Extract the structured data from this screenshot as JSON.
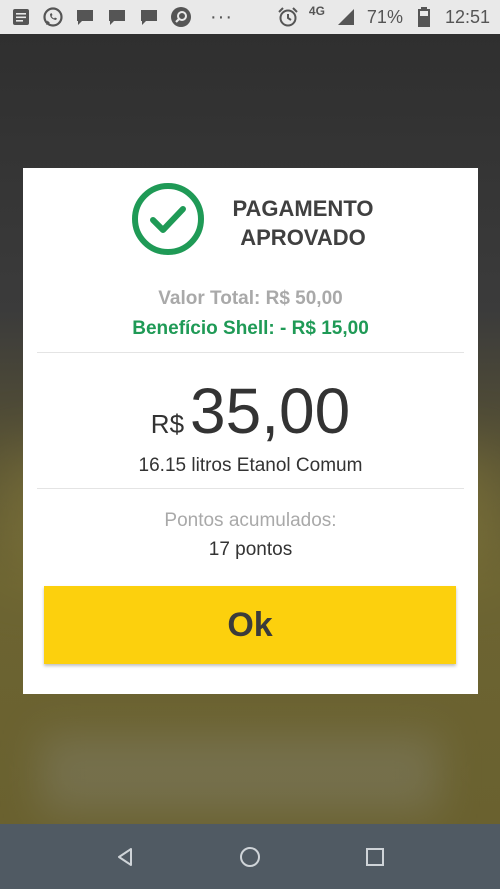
{
  "status_bar": {
    "battery_percent": "71%",
    "network": "4G",
    "time": "12:51",
    "overflow": "···"
  },
  "dialog": {
    "title_line1": "PAGAMENTO",
    "title_line2": "APROVADO",
    "total_value": "Valor Total: R$ 50,00",
    "benefit": "Benefício Shell: - R$ 15,00",
    "currency": "R$",
    "amount": "35,00",
    "fuel": "16.15 litros Etanol Comum",
    "points_label": "Pontos acumulados:",
    "points_value": "17 pontos",
    "ok_label": "Ok"
  },
  "colors": {
    "approved_green": "#1f9a56",
    "ok_yellow": "#fcd00d",
    "nav_bar": "#505a63"
  },
  "icons": [
    "message-icon",
    "whatsapp-icon",
    "chat-icon",
    "chat-icon",
    "chat-icon",
    "search-icon",
    "alarm-icon",
    "signal-icon",
    "battery-icon",
    "check-circle-icon",
    "back-icon",
    "home-icon",
    "recents-icon"
  ]
}
